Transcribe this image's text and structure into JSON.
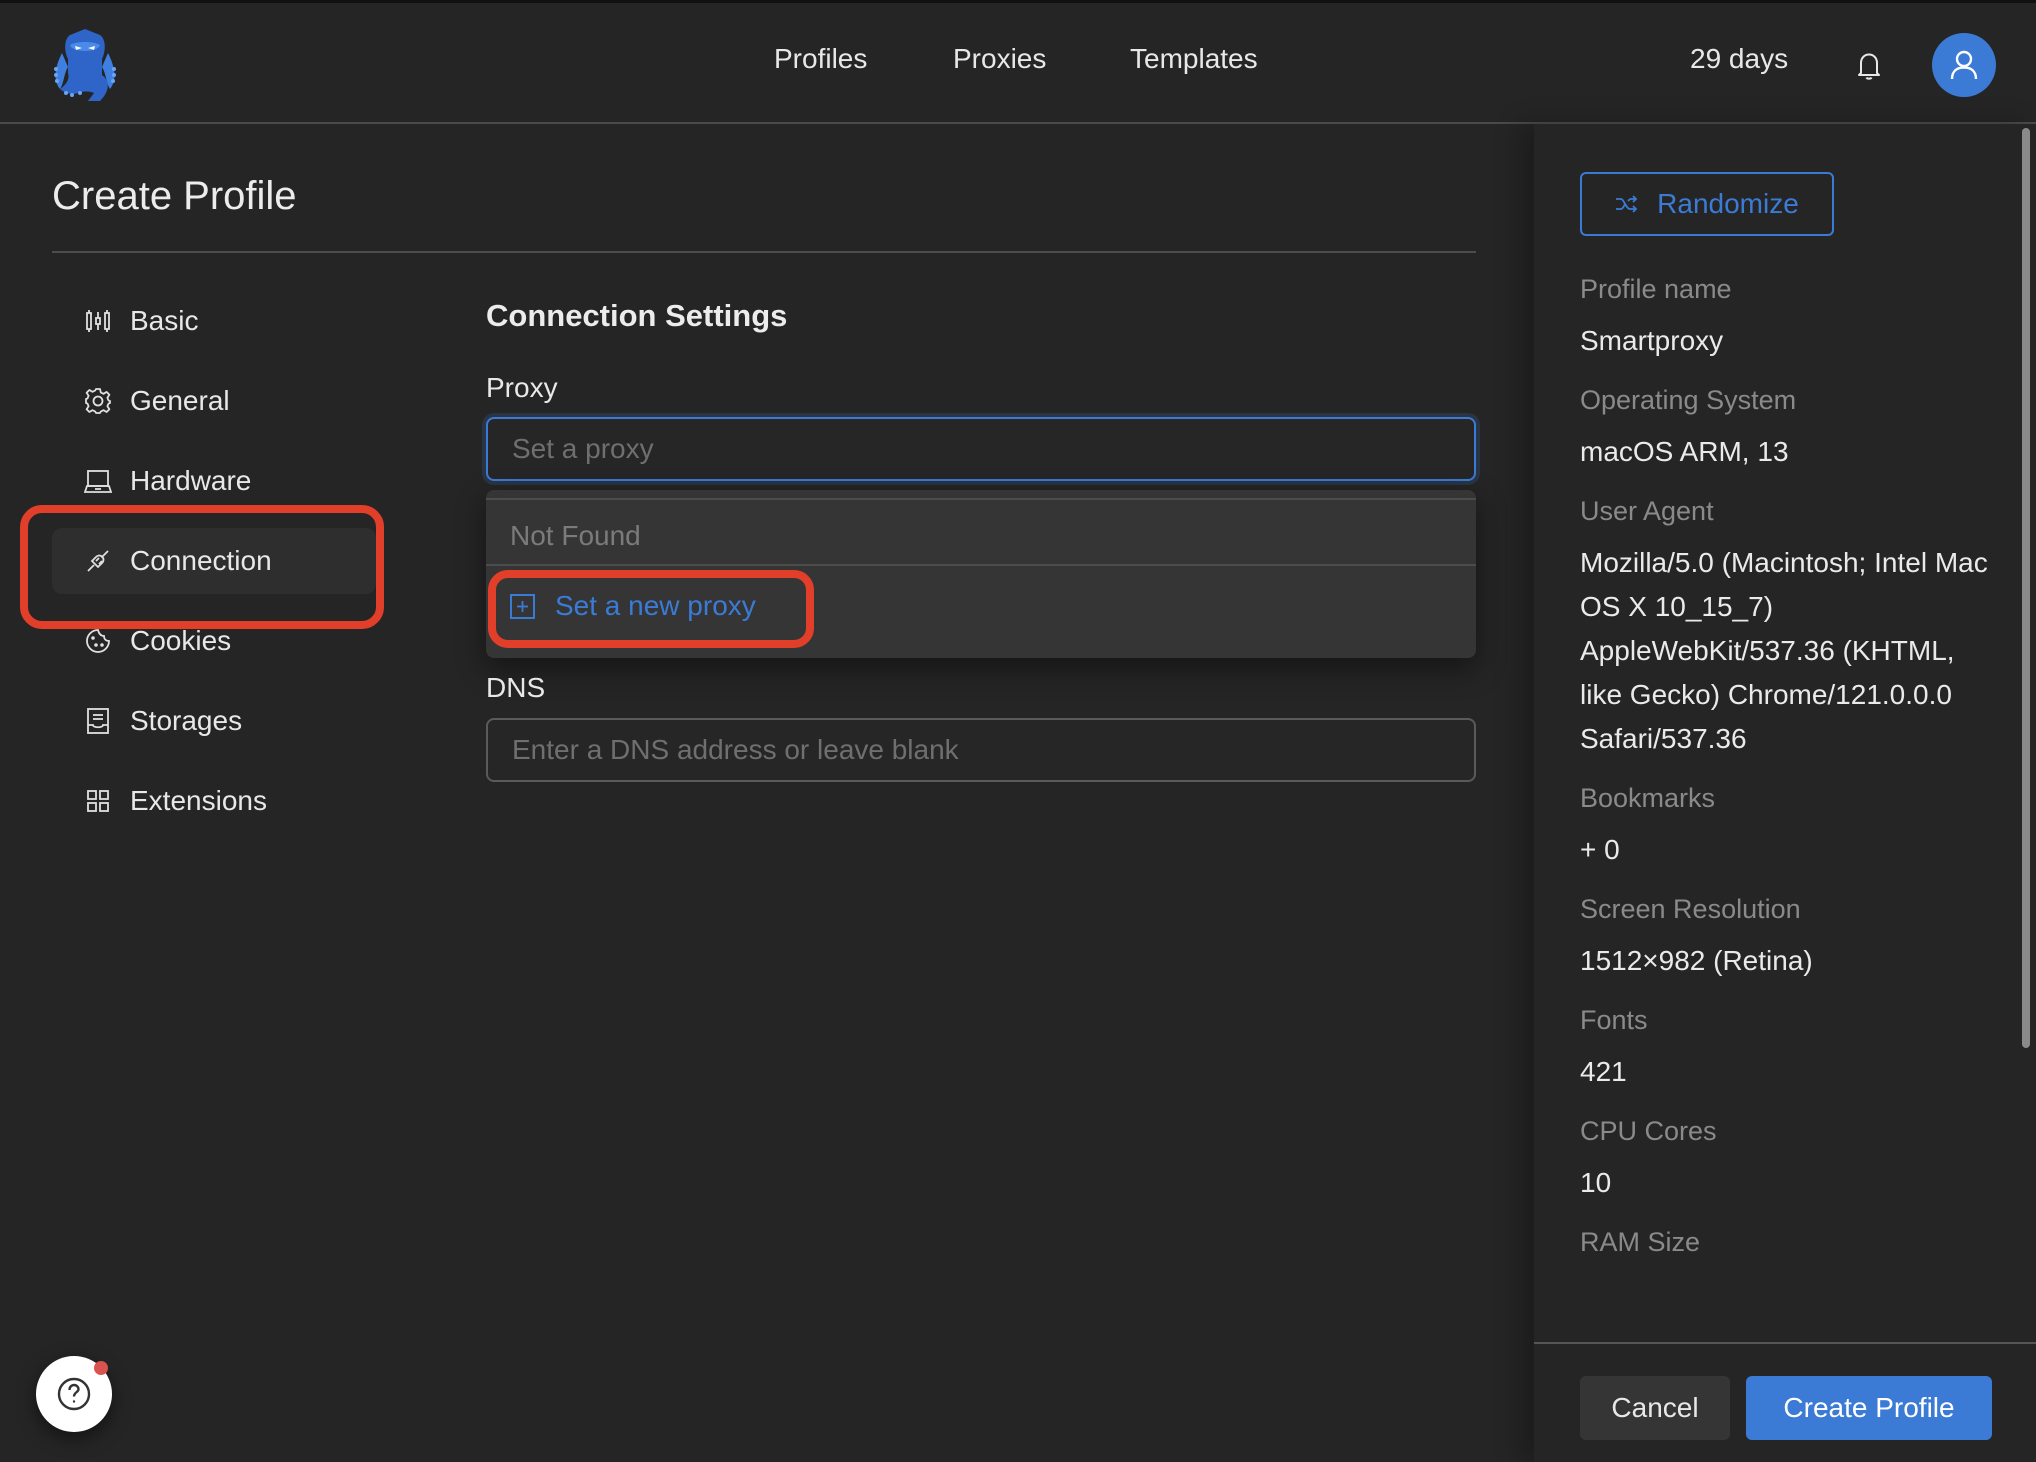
{
  "topbar": {
    "logo_icon": "octopus-logo",
    "nav": [
      {
        "label": "Profiles"
      },
      {
        "label": "Proxies"
      },
      {
        "label": "Templates"
      }
    ],
    "trial_remaining": "29 days",
    "bell_icon": "bell-icon",
    "avatar_icon": "user-icon"
  },
  "page": {
    "title": "Create Profile"
  },
  "sidenav": {
    "active": "Connection",
    "items": [
      {
        "label": "Basic",
        "icon": "sliders-icon"
      },
      {
        "label": "General",
        "icon": "gear-icon"
      },
      {
        "label": "Hardware",
        "icon": "laptop-icon"
      },
      {
        "label": "Connection",
        "icon": "plug-icon"
      },
      {
        "label": "Cookies",
        "icon": "cookie-icon"
      },
      {
        "label": "Storages",
        "icon": "inbox-icon"
      },
      {
        "label": "Extensions",
        "icon": "grid-icon"
      }
    ]
  },
  "connection": {
    "section_title": "Connection Settings",
    "proxy_label": "Proxy",
    "proxy_value": "",
    "proxy_placeholder": "Set a proxy",
    "dropdown": {
      "empty_text": "Not Found",
      "new_proxy_label": "Set a new proxy"
    },
    "dns_label": "DNS",
    "dns_value": "",
    "dns_placeholder": "Enter a DNS address or leave blank"
  },
  "summary": {
    "randomize_label": "Randomize",
    "fields": [
      {
        "label": "Profile name",
        "value": "Smartproxy"
      },
      {
        "label": "Operating System",
        "value": "macOS ARM, 13"
      },
      {
        "label": "User Agent",
        "value": "Mozilla/5.0 (Macintosh; Intel Mac OS X 10_15_7) AppleWebKit/537.36 (KHTML, like Gecko) Chrome/121.0.0.0 Safari/537.36"
      },
      {
        "label": "Bookmarks",
        "value": "+ 0"
      },
      {
        "label": "Screen Resolution",
        "value": "1512×982 (Retina)"
      },
      {
        "label": "Fonts",
        "value": "421"
      },
      {
        "label": "CPU Cores",
        "value": "10"
      },
      {
        "label": "RAM Size",
        "value": ""
      }
    ],
    "cancel_label": "Cancel",
    "create_label": "Create Profile"
  },
  "colors": {
    "accent": "#3b7bd6",
    "highlight": "#e23f2a",
    "background": "#252525",
    "notification_dot": "#d9534f"
  }
}
